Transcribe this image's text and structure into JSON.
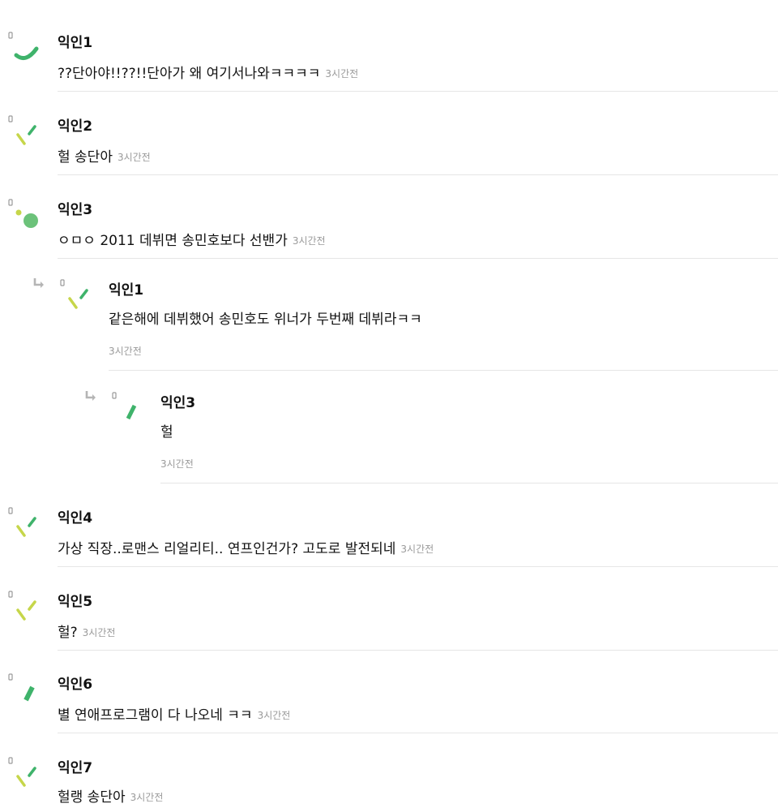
{
  "comments": [
    {
      "author": "익인1",
      "text": "??단아야!!??!!단아가 왜 여기서나와ㅋㅋㅋㅋ",
      "time": "3시간전"
    },
    {
      "author": "익인2",
      "text": "헐 송단아",
      "time": "3시간전"
    },
    {
      "author": "익인3",
      "text": "ㅇㅁㅇ 2011 데뷔면 송민호보다 선밴가",
      "time": "3시간전"
    },
    {
      "author": "익인1",
      "text": "같은해에 데뷔했어 송민호도 위너가 두번째 데뷔라ㅋㅋ",
      "time": "3시간전"
    },
    {
      "author": "익인3",
      "text": "헐",
      "time": "3시간전"
    },
    {
      "author": "익인4",
      "text": "가상 직장..로맨스 리얼리티.. 연프인건가? 고도로 발전되네",
      "time": "3시간전"
    },
    {
      "author": "익인5",
      "text": "헐?",
      "time": "3시간전"
    },
    {
      "author": "익인6",
      "text": "별 연애프로그램이 다 나오네 ㅋㅋ",
      "time": "3시간전"
    },
    {
      "author": "익인7",
      "text": "헐랭 송단아",
      "time": "3시간전"
    }
  ],
  "colors": {
    "divider": "#e6e6e6",
    "timestamp": "#9a9a9a",
    "avatar_green": "#3fb36b",
    "avatar_lime": "#c6d64a",
    "avatar_mid_green": "#6cc27a"
  }
}
